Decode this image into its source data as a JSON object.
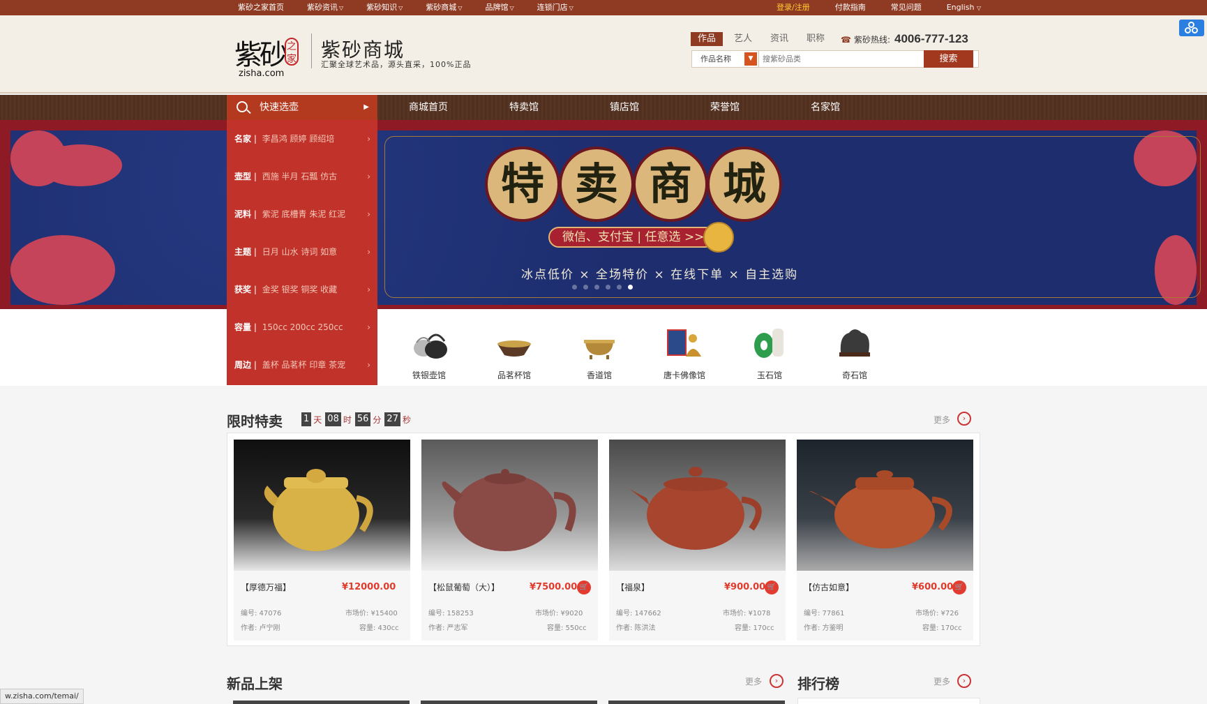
{
  "topbar": {
    "nav": [
      {
        "label": "紫砂之家首页",
        "caret": false
      },
      {
        "label": "紫砂资讯",
        "caret": true
      },
      {
        "label": "紫砂知识",
        "caret": true
      },
      {
        "label": "紫砂商城",
        "caret": true
      },
      {
        "label": "品牌馆",
        "caret": true
      },
      {
        "label": "连锁门店",
        "caret": true
      }
    ],
    "login": "登录/注册",
    "pay_guide": "付款指南",
    "faq": "常见问题",
    "language": "English"
  },
  "header": {
    "logo_main": "紫砂",
    "logo_seal": "之家",
    "logo_url": "zisha.com",
    "title": "紫砂商城",
    "subtitle": "汇聚全球艺术品，源头直采，100%正品",
    "search_tabs": [
      "作品",
      "艺人",
      "资讯",
      "职称"
    ],
    "hotline_label": "紫砂热线:",
    "hotline_number": "4006-777-123",
    "search_select": "作品名称",
    "search_placeholder": "搜紫砂品类",
    "search_button": "搜索"
  },
  "mainnav": {
    "quick_label": "快速选壶",
    "items": [
      "商城首页",
      "特卖馆",
      "镇店馆",
      "荣誉馆",
      "名家馆"
    ]
  },
  "quick_menu": [
    {
      "key": "名家",
      "values": "李昌鸿  顾婷  顾绍培"
    },
    {
      "key": "壶型",
      "values": "西施  半月  石瓢  仿古"
    },
    {
      "key": "泥料",
      "values": "紫泥  底槽青  朱泥  红泥"
    },
    {
      "key": "主题",
      "values": "日月  山水  诗词  如意"
    },
    {
      "key": "获奖",
      "values": "金奖  银奖  铜奖  收藏"
    },
    {
      "key": "容量",
      "values": "150cc  200cc  250cc"
    },
    {
      "key": "周边",
      "values": "盖杯  品茗杯  印章  茶宠"
    }
  ],
  "banner": {
    "title_chars": [
      "特",
      "卖",
      "商",
      "城"
    ],
    "pill_text": "微信、支付宝 | 任意选 >>",
    "slogan": "冰点低价 × 全场特价 × 在线下单 × 自主选购",
    "dots": 6,
    "active_dot": 5
  },
  "categories": [
    {
      "name": "铁银壶馆",
      "icon": "iron-kettle-icon"
    },
    {
      "name": "品茗杯馆",
      "icon": "tea-cup-icon"
    },
    {
      "name": "香道馆",
      "icon": "incense-burner-icon"
    },
    {
      "name": "唐卡佛像馆",
      "icon": "buddha-statue-icon"
    },
    {
      "name": "玉石馆",
      "icon": "jade-icon"
    },
    {
      "name": "奇石馆",
      "icon": "stone-icon"
    }
  ],
  "flash_sale": {
    "title": "限时特卖",
    "countdown": {
      "days": "1",
      "day_unit": "天",
      "hours": "08",
      "hour_unit": "时",
      "minutes": "56",
      "minute_unit": "分",
      "seconds": "27",
      "second_unit": "秒"
    },
    "more": "更多",
    "products": [
      {
        "title": "【厚德万福】",
        "price": "¥12000.00",
        "code": "编号: 47076",
        "market": "市场价: ¥15400",
        "author": "作者: 卢宁刚",
        "capacity": "容量: 430cc",
        "color": "#d9b247",
        "bg": "#1a1a1a"
      },
      {
        "title": "【松鼠葡萄（大）】",
        "price": "¥7500.00",
        "code": "编号: 158253",
        "market": "市场价: ¥9020",
        "author": "作者: 严志军",
        "capacity": "容量: 550cc",
        "color": "#8a4a45",
        "bg": "#777777"
      },
      {
        "title": "【福泉】",
        "price": "¥900.00",
        "code": "编号: 147662",
        "market": "市场价: ¥1078",
        "author": "作者: 陈洪法",
        "capacity": "容量: 170cc",
        "color": "#a8452e",
        "bg": "#6a6a6a"
      },
      {
        "title": "【仿古如意】",
        "price": "¥600.00",
        "code": "编号: 77861",
        "market": "市场价: ¥726",
        "author": "作者: 方鉴明",
        "capacity": "容量: 170cc",
        "color": "#b5542e",
        "bg": "#2a3038"
      }
    ]
  },
  "new_arrivals": {
    "title": "新品上架",
    "more": "更多"
  },
  "ranking": {
    "title": "排行榜",
    "more": "更多"
  },
  "status_url": "w.zisha.com/temai/"
}
